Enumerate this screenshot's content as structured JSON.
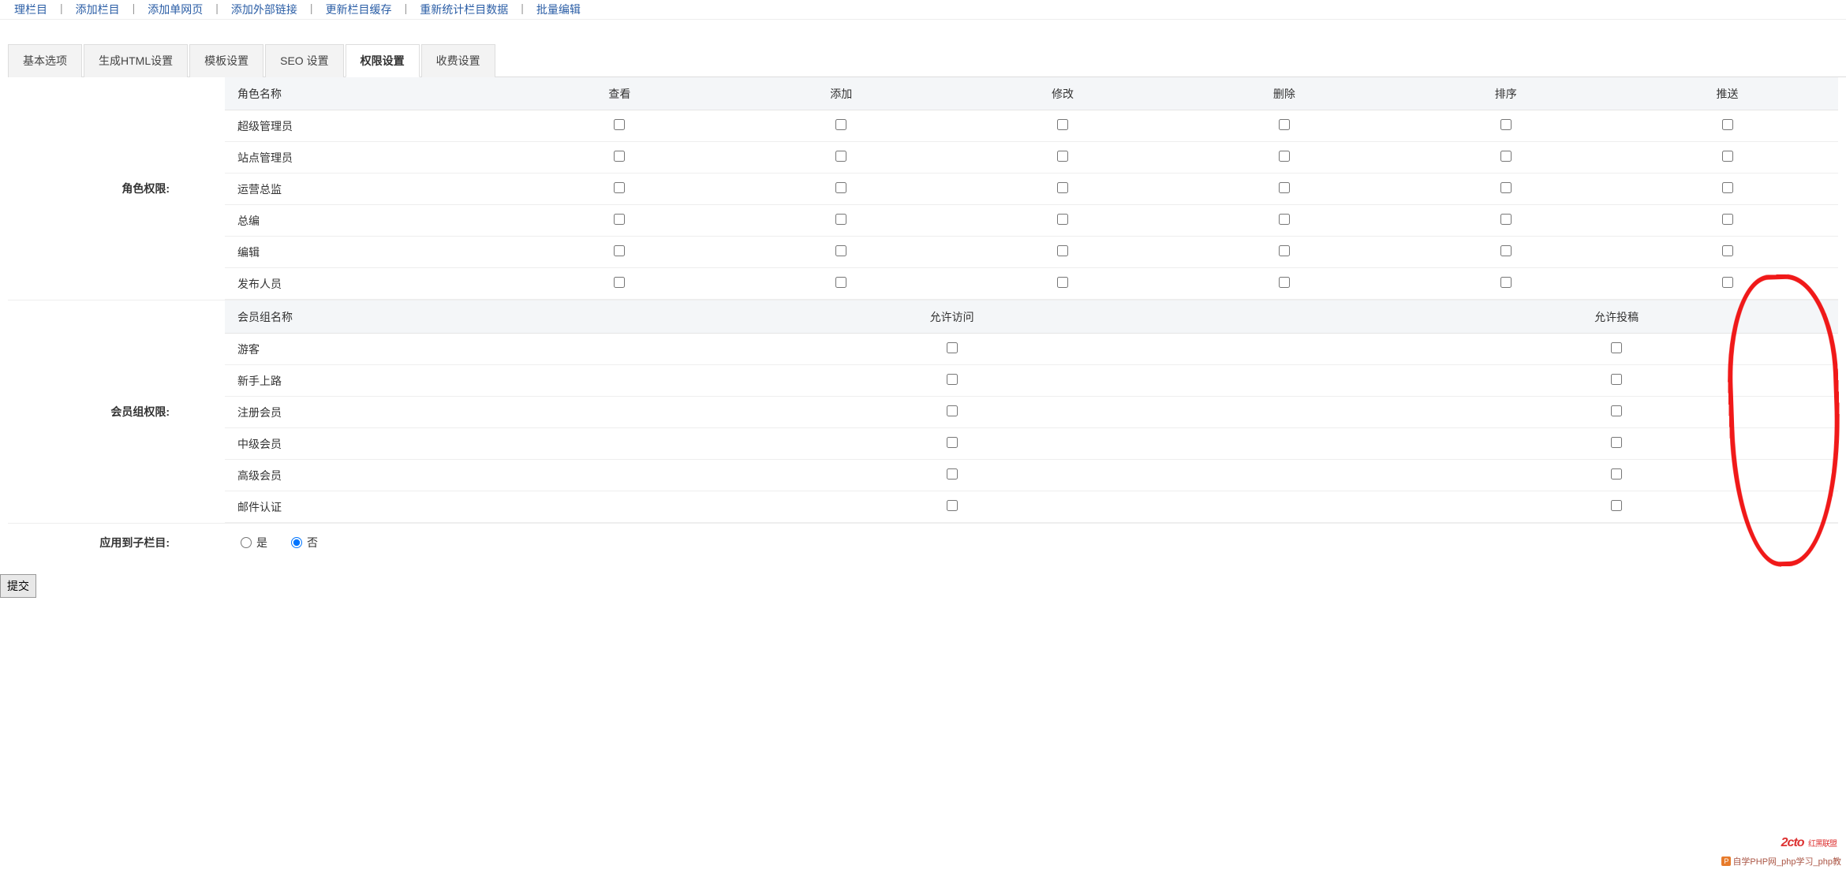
{
  "topnav": [
    {
      "label": "理栏目"
    },
    {
      "label": "添加栏目"
    },
    {
      "label": "添加单网页"
    },
    {
      "label": "添加外部链接"
    },
    {
      "label": "更新栏目缓存"
    },
    {
      "label": "重新统计栏目数据"
    },
    {
      "label": "批量编辑"
    }
  ],
  "tabs": [
    {
      "label": "基本选项",
      "active": false
    },
    {
      "label": "生成HTML设置",
      "active": false
    },
    {
      "label": "模板设置",
      "active": false
    },
    {
      "label": "SEO 设置",
      "active": false
    },
    {
      "label": "权限设置",
      "active": true
    },
    {
      "label": "收费设置",
      "active": false
    }
  ],
  "role_section_label": "角色权限:",
  "role_headers": {
    "name": "角色名称",
    "cols": [
      "查看",
      "添加",
      "修改",
      "删除",
      "排序",
      "推送"
    ]
  },
  "role_rows": [
    {
      "name": "超级管理员",
      "unchecked_all": true
    },
    {
      "name": "站点管理员"
    },
    {
      "name": "运营总监"
    },
    {
      "name": "总编"
    },
    {
      "name": "编辑"
    },
    {
      "name": "发布人员"
    }
  ],
  "member_section_label": "会员组权限:",
  "member_headers": {
    "name": "会员组名称",
    "access": "允许访问",
    "submit": "允许投稿"
  },
  "member_rows": [
    {
      "name": "游客"
    },
    {
      "name": "新手上路"
    },
    {
      "name": "注册会员"
    },
    {
      "name": "中级会员"
    },
    {
      "name": "高级会员"
    },
    {
      "name": "邮件认证"
    }
  ],
  "apply_label": "应用到子栏目:",
  "radio_yes": "是",
  "radio_no": "否",
  "submit_btn": "提交",
  "watermark1_text": "自学PHP网_php学习_php教",
  "watermark2_text": "2cto",
  "watermark2_sub": "红黑联盟"
}
